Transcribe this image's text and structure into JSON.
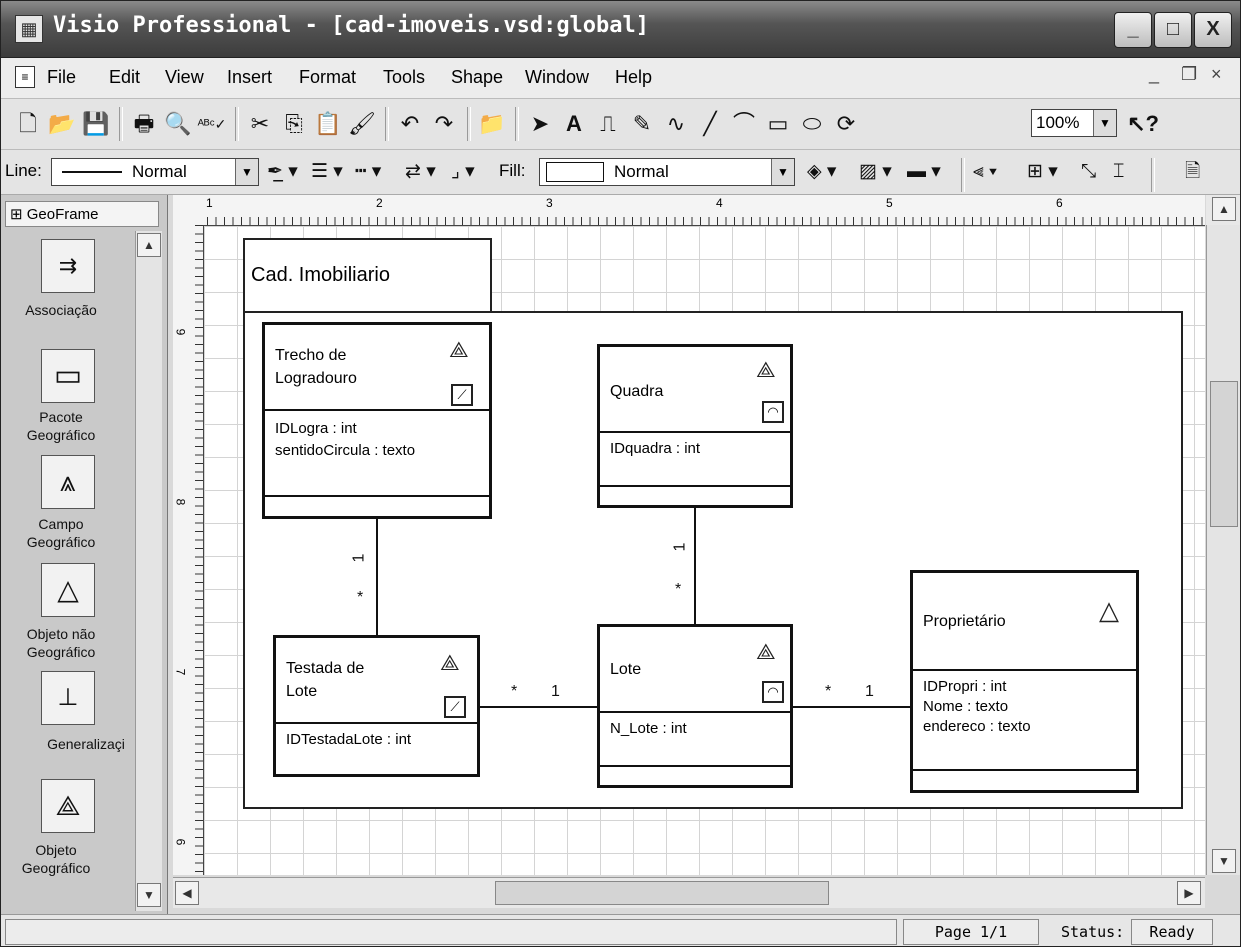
{
  "window": {
    "title": "Visio Professional - [cad-imoveis.vsd:global]",
    "controls": {
      "minimize": "_",
      "maximize": "□",
      "close": "X"
    }
  },
  "menu": {
    "items": [
      "File",
      "Edit",
      "View",
      "Insert",
      "Format",
      "Tools",
      "Shape",
      "Window",
      "Help"
    ],
    "doc_controls": {
      "minimize": "_",
      "restore": "❐",
      "close": "×"
    }
  },
  "toolbar": {
    "zoom": "100%",
    "icons": [
      "new-icon",
      "open-icon",
      "save-icon",
      "print-icon",
      "print-preview-icon",
      "spelling-icon",
      "cut-icon",
      "copy-icon",
      "paste-icon",
      "format-painter-icon",
      "undo-icon",
      "redo-icon",
      "shapes-icon",
      "pointer-icon",
      "text-icon",
      "connector-icon",
      "pencil-icon",
      "freeform-icon",
      "line-icon",
      "arc-icon",
      "rectangle-icon",
      "ellipse-icon",
      "rotate-icon",
      "help-icon"
    ]
  },
  "formatbar": {
    "line_label": "Line:",
    "line_value": "Normal",
    "fill_label": "Fill:",
    "fill_value": "Normal"
  },
  "stencil": {
    "title": "GeoFrame",
    "shapes": [
      {
        "label": "Associação",
        "icon": "association-icon"
      },
      {
        "label": "Pacote Geográfico",
        "icon": "package-icon"
      },
      {
        "label": "Campo Geográfico",
        "icon": "geo-field-icon"
      },
      {
        "label": "Objeto não Geográfico",
        "icon": "non-geo-object-icon"
      },
      {
        "label": "Generalizaçi",
        "icon": "generalization-icon"
      },
      {
        "label": "Objeto Geográfico",
        "icon": "geo-object-icon"
      }
    ]
  },
  "ruler": {
    "h_ticks": [
      "1",
      "2",
      "3",
      "4",
      "5",
      "6"
    ],
    "v_ticks": [
      "9",
      "8",
      "7",
      "6"
    ]
  },
  "diagram": {
    "package_name": "Cad. Imobiliario",
    "classes": {
      "trecho": {
        "name_line1": "Trecho de",
        "name_line2": "Logradouro",
        "attrs": [
          "IDLogra : int",
          "sentidoCircula : texto"
        ]
      },
      "quadra": {
        "name": "Quadra",
        "attrs": [
          "IDquadra : int"
        ]
      },
      "testada": {
        "name_line1": "Testada de",
        "name_line2": "Lote",
        "attrs": [
          "IDTestadaLote : int"
        ]
      },
      "lote": {
        "name": "Lote",
        "attrs": [
          "N_Lote : int"
        ]
      },
      "proprietario": {
        "name": "Proprietário",
        "attrs": [
          "IDPropri : int",
          "Nome : texto",
          "endereco : texto"
        ]
      }
    },
    "multiplicities": {
      "trecho_testada_one": "1",
      "trecho_testada_many": "*",
      "quadra_lote_one": "1",
      "quadra_lote_many": "*",
      "testada_lote_many": "*",
      "testada_lote_one": "1",
      "lote_prop_many": "*",
      "lote_prop_one": "1"
    }
  },
  "status": {
    "page": "Page 1/1",
    "status_label": "Status:",
    "status_value": "Ready"
  }
}
